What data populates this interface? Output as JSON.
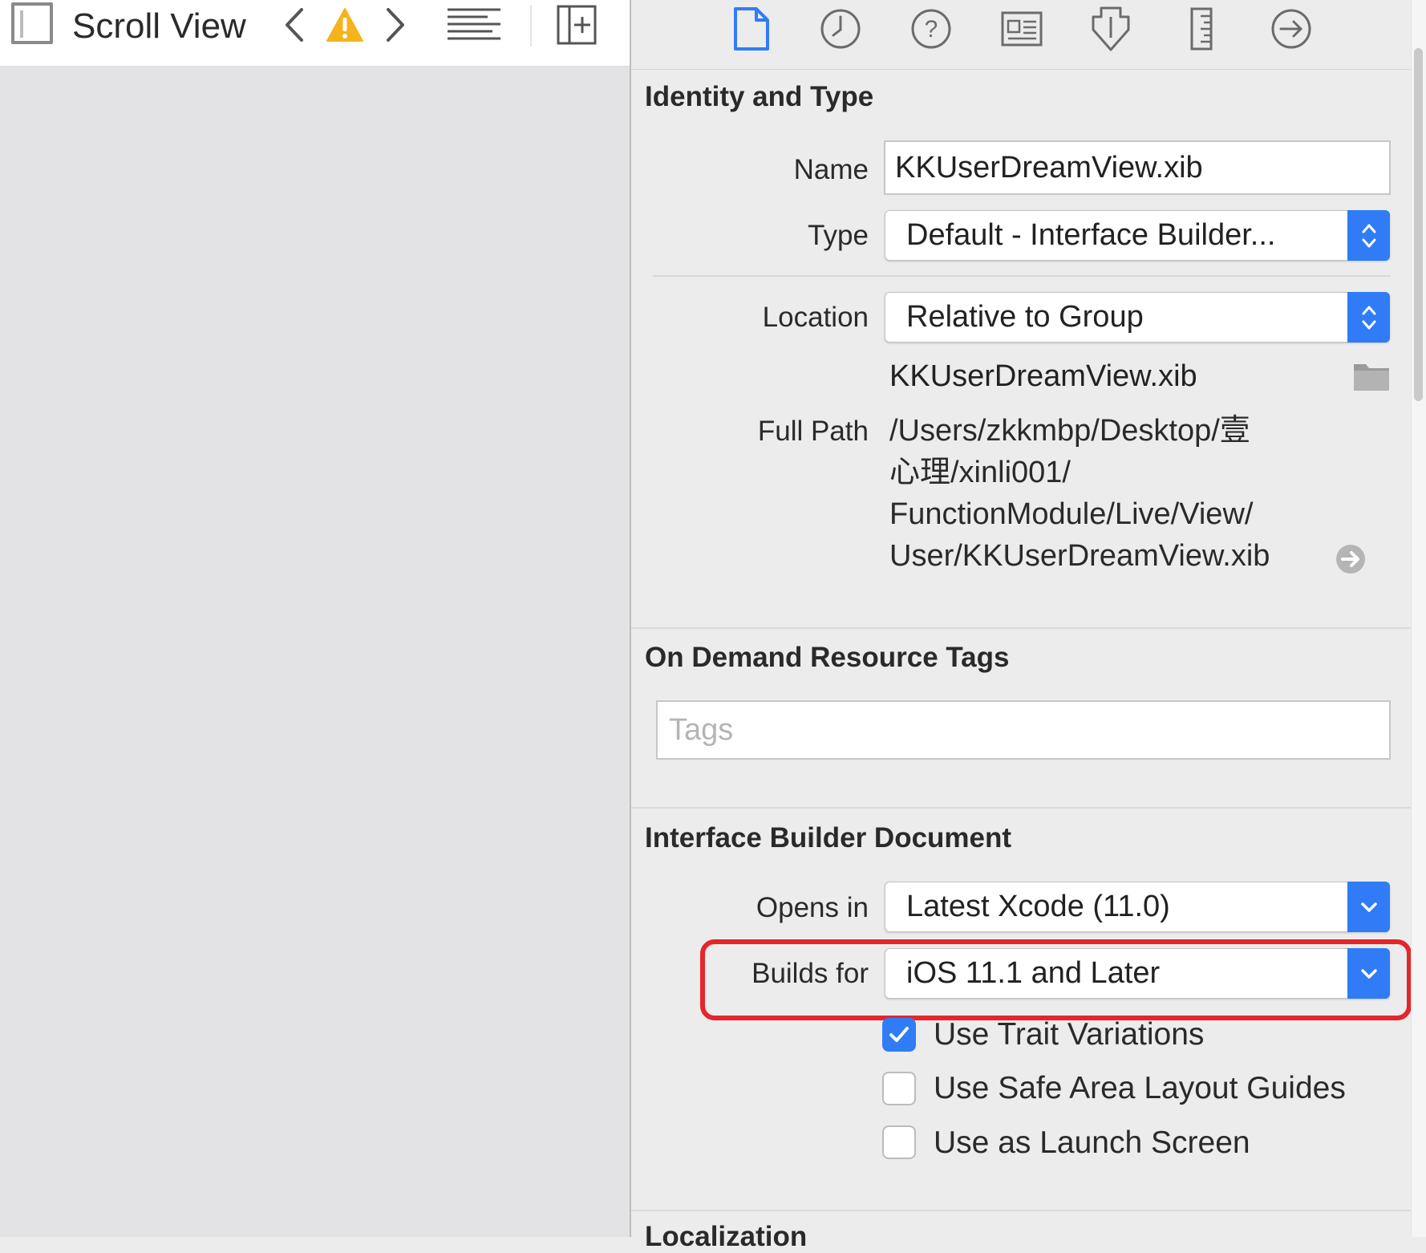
{
  "jumpbar": {
    "title": "Scroll View",
    "icons": [
      "view-icon",
      "back-chevron-icon",
      "warning-icon",
      "forward-chevron-icon",
      "lines-icon",
      "add-editor-icon"
    ]
  },
  "inspector": {
    "tabs": [
      "file-icon",
      "history-icon",
      "quick-help-icon",
      "identity-icon",
      "attributes-icon",
      "size-icon",
      "connections-icon"
    ],
    "identity_and_type": {
      "title": "Identity and Type",
      "name_label": "Name",
      "name_value": "KKUserDreamView.xib",
      "type_label": "Type",
      "type_value": "Default - Interface Builder...",
      "location_label": "Location",
      "location_value": "Relative to Group",
      "file_name": "KKUserDreamView.xib",
      "full_path_label": "Full Path",
      "full_path_lines": [
        "/Users/zkkmbp/Desktop/壹",
        "心理/xinli001/",
        "FunctionModule/Live/View/",
        "User/KKUserDreamView.xib"
      ]
    },
    "on_demand": {
      "title": "On Demand Resource Tags",
      "tags_placeholder": "Tags"
    },
    "ib_document": {
      "title": "Interface Builder Document",
      "opens_in_label": "Opens in",
      "opens_in_value": "Latest Xcode (11.0)",
      "builds_for_label": "Builds for",
      "builds_for_value": "iOS 11.1 and Later",
      "use_trait_variations": "Use Trait Variations",
      "use_trait_variations_checked": true,
      "use_safe_area": "Use Safe Area Layout Guides",
      "use_safe_area_checked": false,
      "use_as_launch_screen": "Use as Launch Screen",
      "use_as_launch_screen_checked": false
    },
    "localization": {
      "title": "Localization"
    }
  },
  "colors": {
    "accent": "#2f7cf6",
    "highlight": "#e5262b",
    "warning": "#f5b41b"
  }
}
